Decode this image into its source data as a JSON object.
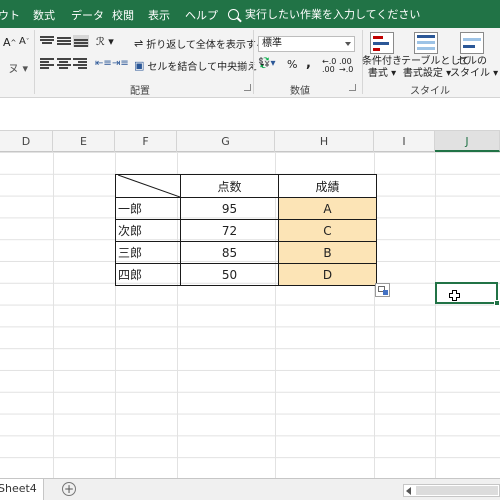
{
  "menu": {
    "items": [
      "ウト",
      "数式",
      "データ",
      "校閲",
      "表示",
      "ヘルプ"
    ],
    "tell_me": "実行したい作業を入力してください"
  },
  "ribbon": {
    "alignment": {
      "wrap_text": "折り返して全体を表示する",
      "merge_center": "セルを結合して中央揃え",
      "group_label": "配置"
    },
    "number": {
      "format_value": "標準",
      "percent": "%",
      "comma": ",",
      "group_label": "数値"
    },
    "styles": {
      "conditional_format": [
        "条件付き",
        "書式"
      ],
      "format_as_table": [
        "テーブルとして",
        "書式設定"
      ],
      "cell_styles": [
        "セルの",
        "スタイル"
      ],
      "group_label": "スタイル"
    }
  },
  "grid": {
    "columns": [
      "D",
      "E",
      "F",
      "G",
      "H",
      "I",
      "J"
    ],
    "active_column": "J"
  },
  "table": {
    "headers": [
      "",
      "点数",
      "成績"
    ],
    "rows": [
      {
        "name": "一郎",
        "score": "95",
        "grade": "A"
      },
      {
        "name": "次郎",
        "score": "72",
        "grade": "C"
      },
      {
        "name": "三郎",
        "score": "85",
        "grade": "B"
      },
      {
        "name": "四郎",
        "score": "50",
        "grade": "D"
      }
    ]
  },
  "sheets": {
    "tabs": [
      "Sheet4"
    ],
    "add_label": "+"
  },
  "colors": {
    "accent": "#217346",
    "grade_fill": "#fce4b6"
  }
}
